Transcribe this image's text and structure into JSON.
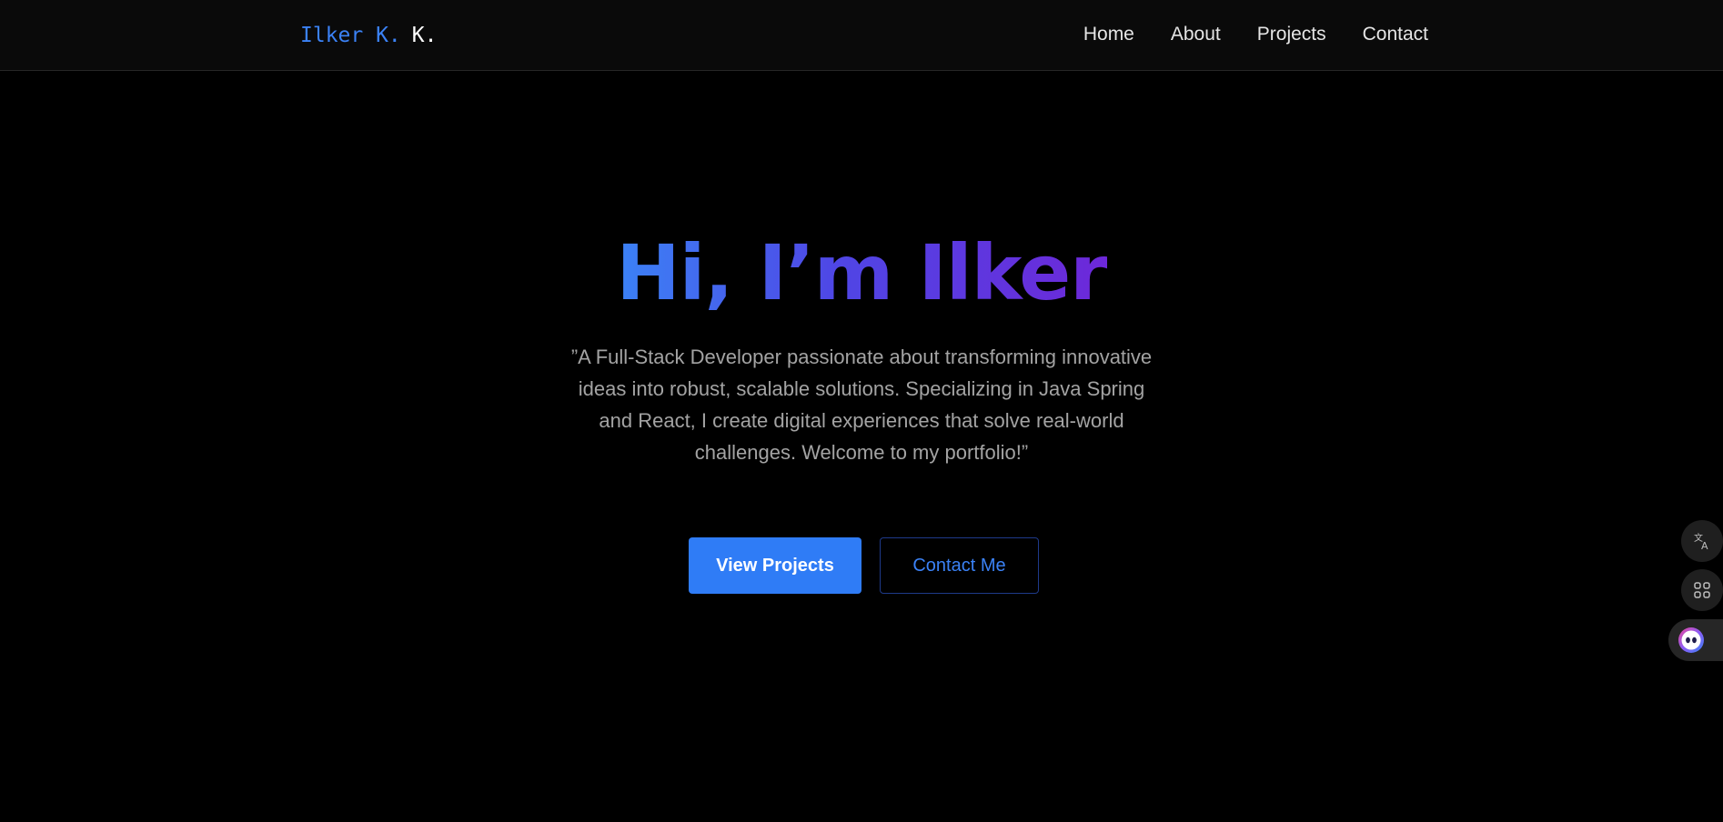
{
  "nav": {
    "logo_main": "Ilker K.",
    "logo_accent": "K.",
    "links": [
      "Home",
      "About",
      "Projects",
      "Contact"
    ]
  },
  "hero": {
    "title": "Hi, I’m Ilker",
    "subtitle": "”A Full-Stack Developer passionate about transforming innovative ideas into robust, scalable solutions. Specializing in Java Spring and React, I create digital experiences that solve real-world challenges. Welcome to my portfolio!”",
    "primary_button": "View Projects",
    "secondary_button": "Contact Me"
  },
  "side_widgets": {
    "icons": [
      "translate-icon",
      "apps-grid-icon",
      "ai-assistant-icon"
    ]
  },
  "colors": {
    "accent": "#3b82f6",
    "button_primary": "#2f7cf6",
    "title_gradient_start": "#3b82f6",
    "title_gradient_end": "#6d28d9",
    "background": "#000000",
    "nav_background": "#0a0a0a",
    "subtitle_text": "#a3a3a3"
  }
}
